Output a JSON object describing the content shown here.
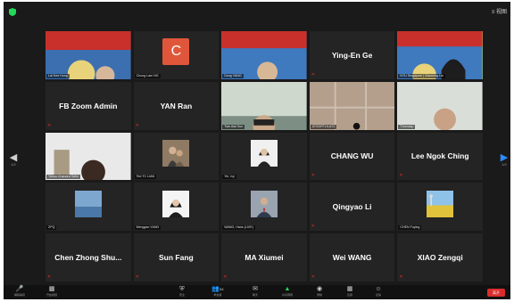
{
  "toolbar_view": "≡ 视图",
  "pages": {
    "left": "1/2",
    "right": "1/2"
  },
  "tiles": [
    {
      "type": "video",
      "name": "Lai Kee Hung",
      "scene": "poster-man"
    },
    {
      "type": "avatar",
      "initial": "C",
      "name": "Chung Lam NG"
    },
    {
      "type": "video",
      "name": "Dong YANG",
      "scene": "poster-man2"
    },
    {
      "type": "text",
      "big": "Ying-En Ge"
    },
    {
      "type": "video",
      "name": "NTU Singapore | Xiaoming Lin",
      "scene": "poster-woman",
      "active": true
    },
    {
      "type": "text",
      "big": "FB Zoom Admin"
    },
    {
      "type": "text",
      "big": "YAN Ran"
    },
    {
      "type": "video",
      "name": "Tian Aiai Sun",
      "scene": "office-man"
    },
    {
      "type": "video",
      "name": "ATSOFFL9-AT2",
      "scene": "ceiling"
    },
    {
      "type": "video",
      "name": "Thomasp",
      "scene": "bright-man"
    },
    {
      "type": "video",
      "name": "Yasuo Chandra Sahu",
      "scene": "dark-man"
    },
    {
      "type": "photo",
      "name": "Ted TC LIAN",
      "scene": "two-people"
    },
    {
      "type": "photo",
      "name": "Yin, Ivy",
      "scene": "woman-portrait"
    },
    {
      "type": "text",
      "big": "CHANG WU"
    },
    {
      "type": "text",
      "big": "Lee Ngok Ching"
    },
    {
      "type": "photo",
      "name": "ZPQ",
      "scene": "sea"
    },
    {
      "type": "photo",
      "name": "Mengyao YANG",
      "scene": "woman-portrait2"
    },
    {
      "type": "photo",
      "name": "WANG, Hans (LIVE)",
      "scene": "man-suit"
    },
    {
      "type": "text",
      "big": "Qingyao Li"
    },
    {
      "type": "photo",
      "name": "CHEN Fuying",
      "scene": "field"
    },
    {
      "type": "text",
      "big": "Chen Zhong Shu..."
    },
    {
      "type": "text",
      "big": "Sun Fang"
    },
    {
      "type": "text",
      "big": "MA Xiumei"
    },
    {
      "type": "text",
      "big": "Wei WANG"
    },
    {
      "type": "text",
      "big": "XIAO Zengqi"
    }
  ],
  "toolbar": {
    "mute": "解除静音",
    "video": "开启视频",
    "security": "安全",
    "participants": "参会者",
    "participants_count": "64",
    "chat": "聊天",
    "share": "共享屏幕",
    "record": "录制",
    "apps": "应用",
    "reactions": "表情",
    "end": "离开",
    "colors": {
      "end": "#d92d2d",
      "share": "#23d959",
      "accent": "#2d8cff"
    }
  }
}
